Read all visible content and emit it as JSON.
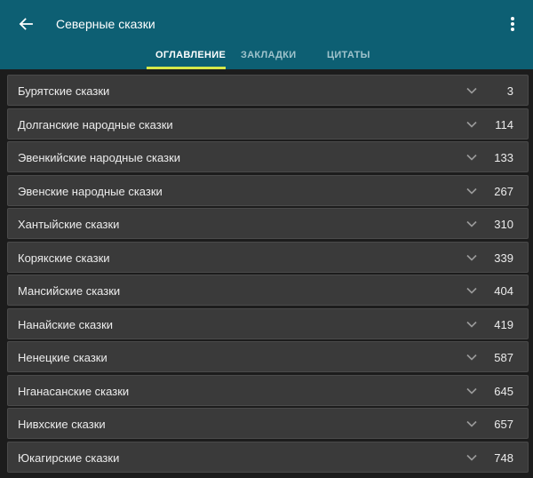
{
  "header": {
    "title": "Северные сказки",
    "back_icon": "arrow-left-icon",
    "menu_icon": "more-vertical-icon",
    "background": "#0d5f73"
  },
  "tabs": [
    {
      "label": "ОГЛАВЛЕНИЕ",
      "active": true
    },
    {
      "label": "ЗАКЛАДКИ",
      "active": false
    },
    {
      "label": "ЦИТАТЫ",
      "active": false
    }
  ],
  "accent_color": "#d6e84a",
  "toc": {
    "expand_icon": "chevron-down-icon",
    "items": [
      {
        "label": "Бурятские сказки",
        "page": "3"
      },
      {
        "label": "Долганские народные сказки",
        "page": "114"
      },
      {
        "label": "Эвенкийские народные сказки",
        "page": "133"
      },
      {
        "label": "Эвенские народные сказки",
        "page": "267"
      },
      {
        "label": "Хантыйские сказки",
        "page": "310"
      },
      {
        "label": "Корякские сказки",
        "page": "339"
      },
      {
        "label": "Мансийские сказки",
        "page": "404"
      },
      {
        "label": "Нанайские сказки",
        "page": "419"
      },
      {
        "label": "Ненецкие сказки",
        "page": "587"
      },
      {
        "label": "Нганасанские сказки",
        "page": "645"
      },
      {
        "label": "Нивхские сказки",
        "page": "657"
      },
      {
        "label": "Юкагирские сказки",
        "page": "748"
      }
    ]
  }
}
